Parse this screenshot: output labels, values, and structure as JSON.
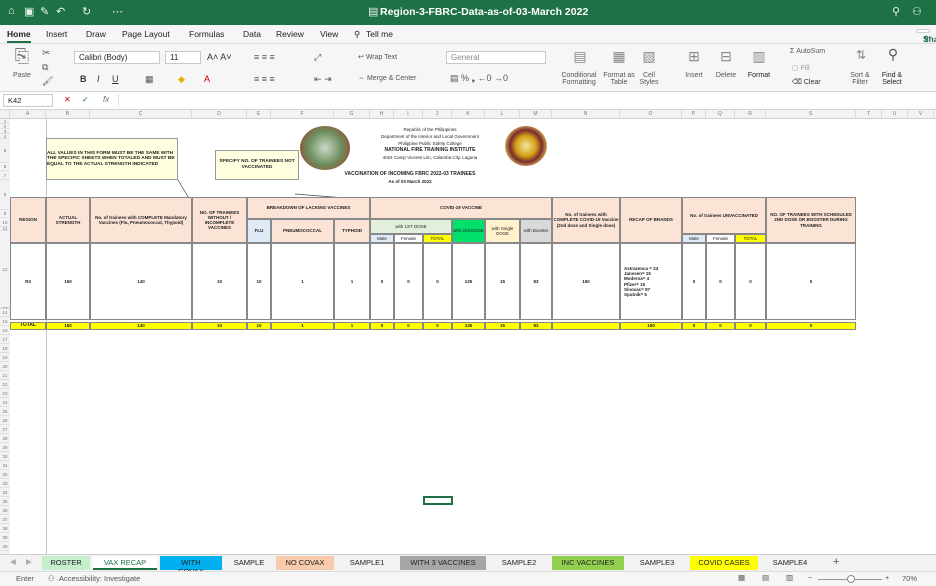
{
  "window": {
    "title": "Region-3-FBRC-Data-as-of-03-March 2022"
  },
  "menu": [
    "Home",
    "Insert",
    "Draw",
    "Page Layout",
    "Formulas",
    "Data",
    "Review",
    "View"
  ],
  "tell_me": "Tell me",
  "share": "Share",
  "ribbon": {
    "paste": "Paste",
    "font": "Calibri (Body)",
    "size": "11",
    "wrap": "Wrap Text",
    "merge": "Merge & Center",
    "number_format": "General",
    "cond": "Conditional Formatting",
    "fmt_table": "Format as Table",
    "cell_styles": "Cell Styles",
    "insert": "Insert",
    "delete": "Delete",
    "format": "Format",
    "autosum": "AutoSum",
    "fill": "Fill",
    "clear": "Clear",
    "sort": "Sort & Filter",
    "find": "Find & Select"
  },
  "formula_bar": {
    "cell_ref": "K42",
    "fx": "fx",
    "value": ""
  },
  "columns": [
    "A",
    "B",
    "C",
    "D",
    "E",
    "F",
    "G",
    "H",
    "I",
    "J",
    "K",
    "L",
    "M",
    "N",
    "O",
    "P",
    "Q",
    "R",
    "S",
    "T",
    "U",
    "V",
    "W"
  ],
  "header_info": {
    "l1": "Republic of the Philippines",
    "l2": "Department of the Interior and Local Government",
    "l3": "Philippine Public Safety College",
    "l4": "NATIONAL FIRE TRAINING INSTITUTE",
    "l5": "4024 Camp Vicente Lim, Calamba City, Laguna",
    "l6": "VACCINATION OF INCOMING FBRC 2022-03 TRAINEES",
    "l7": "As of 03 March 2022"
  },
  "notes": {
    "n1": "ALL VALUES IN THIS FORM MUST BE THE SAME WITH THE SPECIFIC SHEETS WHEN TOTALED AND MUST BE EQUAL TO THE ACTUAL STRENGTH INDICATED",
    "n2": "SPECIFY NO. OF TRAINEES NOT VACCINATED"
  },
  "table_headers": {
    "region": "REGION",
    "actual": "ACTUAL STRENGTH",
    "complete": "No. of trainees with COMPLETE Mandatory Vaccines (Flu, Pneumococcal, Thypoid)",
    "without": "NO. OF TRAINEES WITHOUT / INCOMPLETE VACCINES",
    "breakdown": "BREAKDOWN OF LACKING VACCINES",
    "flu": "FLU",
    "pneumo": "PNEUMOCOCCAL",
    "typhoid": "TYPHOID",
    "covid": "COVID-19 VACCINE",
    "first_dose": "with 1ST DOSE",
    "male": "Male",
    "female": "Female",
    "total": "TOTAL",
    "second_dose": "with 2nd DOSE",
    "single_dose": "with Single DOSE",
    "booster": "with Booster",
    "complete_covid": "No. of trainees with COMPLETE COVID-19 Vaccine (2nd dose and Single dose)",
    "recap": "RECAP OF BRANDS",
    "unvacc": "No. of trainees UNVACCINATED",
    "scheduled": "NO. OF TRAINEES WITH SCHEDULED 2ND DOSE OR BOOSTER DURING TRAINING"
  },
  "row_r3": {
    "region": "R3",
    "actual": "150",
    "complete": "140",
    "without": "10",
    "flu": "10",
    "pneumo": "1",
    "typhoid": "1",
    "m": "0",
    "f": "0",
    "t": "0",
    "second": "135",
    "single": "15",
    "booster": "83",
    "complete_covid": "150",
    "brands": [
      "Astrazenca = 24",
      "Janssen= 15",
      "Moderna= 4",
      "Pfizer= 15",
      "Sinovac= 87",
      "Sputnik= 5"
    ],
    "um": "0",
    "uf": "0",
    "ut": "0",
    "sched": "0"
  },
  "row_total": {
    "label": "TOTAL",
    "actual": "150",
    "complete": "140",
    "without": "10",
    "flu": "10",
    "pneumo": "1",
    "typhoid": "1",
    "m": "0",
    "f": "0",
    "t": "0",
    "second": "135",
    "single": "15",
    "booster": "83",
    "recap": "150",
    "um": "0",
    "uf": "0",
    "ut": "0",
    "sched": "0"
  },
  "sheets": [
    {
      "name": "ROSTER",
      "bg": "#c6efce"
    },
    {
      "name": "VAX RECAP",
      "bg": "#ffffff"
    },
    {
      "name": "WITH COVAX",
      "bg": "#00b0f0"
    },
    {
      "name": "SAMPLE",
      "bg": "#f2f2f2"
    },
    {
      "name": "NO COVAX",
      "bg": "#f8cbad"
    },
    {
      "name": "SAMPLE1",
      "bg": "#f2f2f2"
    },
    {
      "name": "WITH 3 VACCINES",
      "bg": "#a6a6a6"
    },
    {
      "name": "SAMPLE2",
      "bg": "#f2f2f2"
    },
    {
      "name": "INC VACCINES",
      "bg": "#92d050"
    },
    {
      "name": "SAMPLE3",
      "bg": "#f2f2f2"
    },
    {
      "name": "COVID CASES",
      "bg": "#ffff00"
    },
    {
      "name": "SAMPLE4",
      "bg": "#f2f2f2"
    }
  ],
  "status": {
    "mode": "Enter",
    "accessibility": "Accessibility: Investigate",
    "zoom": "70%"
  }
}
